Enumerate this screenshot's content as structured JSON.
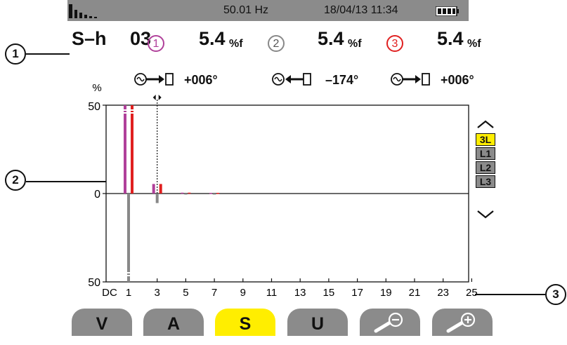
{
  "status": {
    "freq": "50.01 Hz",
    "datetime": "18/04/13  11:34",
    "battery_icon": "battery-full-icon",
    "mode_icon": "harmonics-icon"
  },
  "header": {
    "mode": "S–h",
    "order": "03",
    "phases": [
      {
        "id": "1",
        "value": "5.4",
        "unit": "%f",
        "color": "#b0409a"
      },
      {
        "id": "2",
        "value": "5.4",
        "unit": "%f",
        "color": "#888888"
      },
      {
        "id": "3",
        "value": "5.4",
        "unit": "%f",
        "color": "#e02020"
      }
    ],
    "angles": [
      {
        "dir": "arrow-right-icon",
        "value": "+006°"
      },
      {
        "dir": "arrow-left-icon",
        "value": "–174°"
      },
      {
        "dir": "arrow-right-icon",
        "value": "+006°"
      }
    ]
  },
  "side_selector": {
    "items": [
      "3L",
      "L1",
      "L2",
      "L3"
    ],
    "active": "3L",
    "active_color": "#ffee00",
    "inactive_color": "#8b8b8b"
  },
  "callouts": [
    "1",
    "2",
    "3"
  ],
  "tabs": [
    {
      "label": "V"
    },
    {
      "label": "A"
    },
    {
      "label": "S",
      "active": true
    },
    {
      "label": "U"
    },
    {
      "label": "",
      "icon": "zoom-out-icon"
    },
    {
      "label": "",
      "icon": "zoom-in-icon"
    }
  ],
  "chart_data": {
    "type": "bar",
    "ylabel": "%",
    "y_tick_labels": [
      "50",
      "0",
      "50"
    ],
    "ylim": [
      -50,
      50
    ],
    "x_tick_labels": [
      "DC",
      "1",
      "3",
      "5",
      "7",
      "9",
      "11",
      "13",
      "15",
      "17",
      "19",
      "21",
      "23",
      "25"
    ],
    "cursor_order": 3,
    "series": [
      {
        "name": "1",
        "color": "#b0409a",
        "values": {
          "1": 50,
          "3": 5.4,
          "5": 0.5,
          "7": 0.4
        }
      },
      {
        "name": "2",
        "color": "#888888",
        "values": {
          "1": -50,
          "3": -5.4,
          "5": -0.5,
          "7": -0.4
        }
      },
      {
        "name": "3",
        "color": "#e02020",
        "values": {
          "1": 50,
          "3": 5.4,
          "5": 0.5,
          "7": 0.4
        }
      }
    ]
  }
}
